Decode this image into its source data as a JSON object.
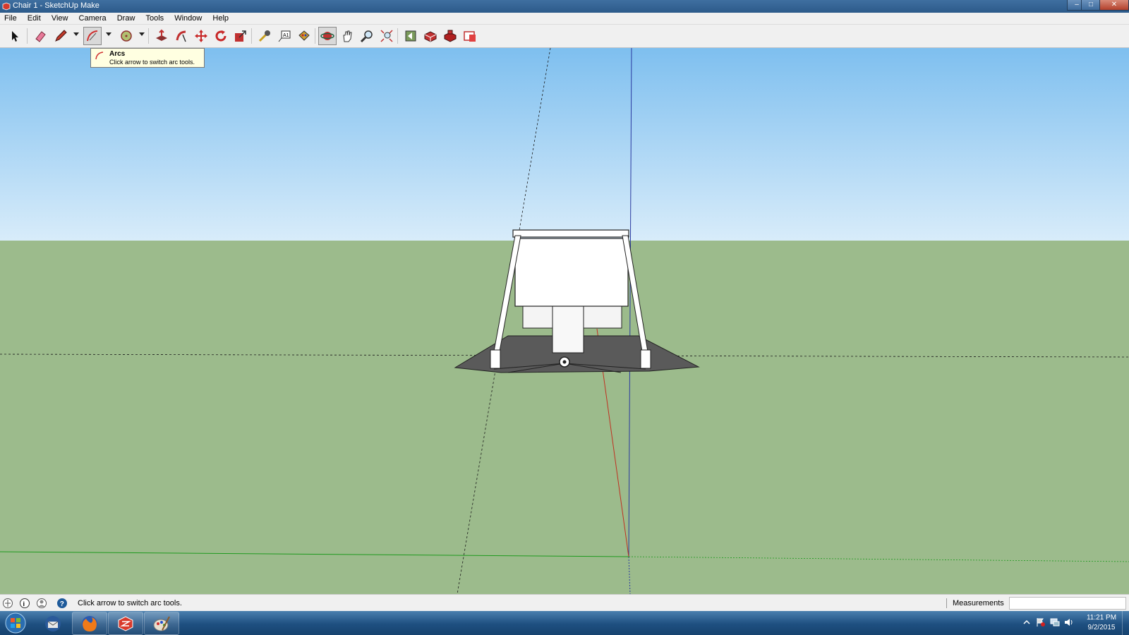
{
  "window": {
    "title": "Chair 1 - SketchUp Make",
    "controls": [
      "minimize-icon",
      "maximize-icon",
      "close-icon"
    ]
  },
  "menu": {
    "items": [
      "File",
      "Edit",
      "View",
      "Camera",
      "Draw",
      "Tools",
      "Window",
      "Help"
    ]
  },
  "toolbar": {
    "tools": [
      "select-arrow-icon",
      "eraser-icon",
      "pencil-line-icon",
      "arc-icon",
      "circle-icon",
      "push-pull-icon",
      "follow-me-icon",
      "move-icon",
      "rotate-icon",
      "scale-icon",
      "tape-measure-icon",
      "text-icon",
      "paint-bucket-icon",
      "orbit-icon",
      "pan-icon",
      "zoom-icon",
      "zoom-extents-icon",
      "previous-view-icon",
      "3d-warehouse-icon",
      "extension-warehouse-icon",
      "layout-icon"
    ],
    "active_tool": "orbit-icon"
  },
  "tooltip": {
    "title": "Arcs",
    "description": "Click arrow to switch arc tools."
  },
  "viewport": {
    "sky_color": "#8cc4ee",
    "ground_color": "#9cbb8c",
    "model": "chair"
  },
  "statusbar": {
    "hint": "Click arrow to switch arc tools.",
    "measurements_label": "Measurements",
    "measurements_value": ""
  },
  "taskbar": {
    "apps": [
      "start-orb-icon",
      "thunderbird-icon",
      "firefox-icon",
      "sketchup-icon",
      "paint-icon"
    ],
    "clock_time": "11:21 PM",
    "clock_date": "9/2/2015"
  }
}
